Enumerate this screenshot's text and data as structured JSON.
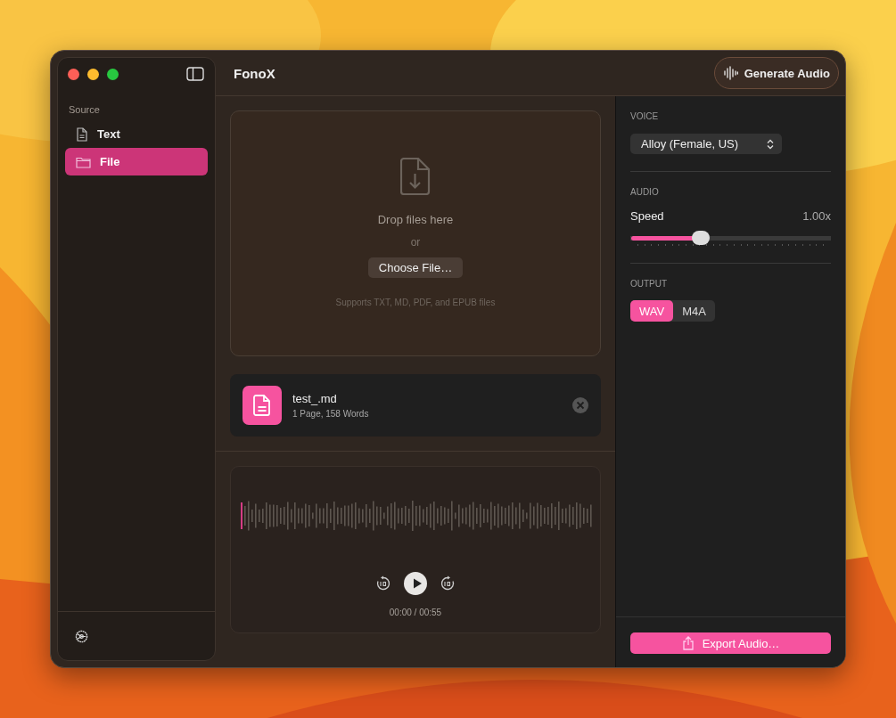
{
  "window": {
    "title": "FonoX"
  },
  "sidebar": {
    "section": "Source",
    "items": [
      {
        "label": "Text",
        "kind": "document",
        "selected": false
      },
      {
        "label": "File",
        "kind": "folder",
        "selected": true
      }
    ]
  },
  "toolbar": {
    "generate_button": "Generate Audio"
  },
  "drop_zone": {
    "title": "Drop files here",
    "separator": "or",
    "button": "Choose File…",
    "hint": "Supports TXT, MD, PDF, and EPUB files"
  },
  "file": {
    "name": "test_.md",
    "details": "1 Page, 158 Words"
  },
  "player": {
    "time": "00:00 / 00:55"
  },
  "settings": {
    "voice": {
      "heading": "VOICE",
      "value": "Alloy (Female, US)"
    },
    "audio": {
      "heading": "AUDIO",
      "label": "Speed",
      "reading": "1.00x",
      "level": 0.35
    },
    "output": {
      "heading": "OUTPUT",
      "formats": [
        {
          "label": "WAV",
          "selected": true
        },
        {
          "label": "M4A",
          "selected": false
        }
      ]
    }
  },
  "export_button": "Export Audio…"
}
